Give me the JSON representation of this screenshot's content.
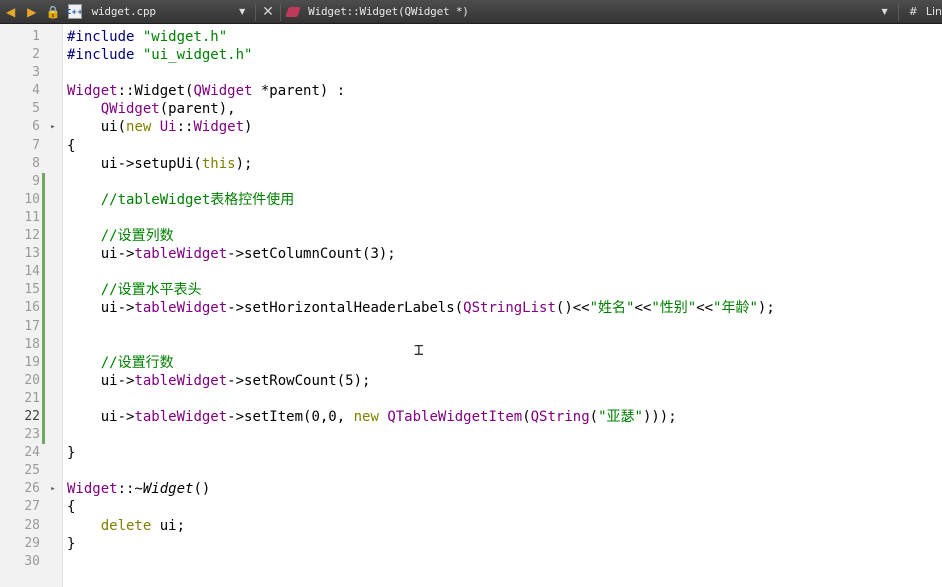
{
  "toolbar": {
    "file_name": "widget.cpp",
    "file_icon_text": "C++",
    "symbol": "Widget::Widget(QWidget *)",
    "hash": "#",
    "line_label": "Lin"
  },
  "editor": {
    "current_line": 22,
    "lines": [
      {
        "n": "1",
        "parts": [
          [
            "c-dir",
            "#include"
          ],
          [
            "",
            " "
          ],
          [
            "c-str",
            "\"widget.h\""
          ]
        ]
      },
      {
        "n": "2",
        "parts": [
          [
            "c-dir",
            "#include"
          ],
          [
            "",
            " "
          ],
          [
            "c-str",
            "\"ui_widget.h\""
          ]
        ]
      },
      {
        "n": "3",
        "parts": []
      },
      {
        "n": "4",
        "parts": [
          [
            "c-type",
            "Widget"
          ],
          [
            "",
            "::Widget("
          ],
          [
            "c-type",
            "QWidget"
          ],
          [
            "",
            " *parent) :"
          ]
        ]
      },
      {
        "n": "5",
        "parts": [
          [
            "",
            "    "
          ],
          [
            "c-type",
            "QWidget"
          ],
          [
            "",
            "(parent),"
          ]
        ]
      },
      {
        "n": "6",
        "fold": "▸",
        "parts": [
          [
            "",
            "    ui("
          ],
          [
            "c-kw",
            "new"
          ],
          [
            "",
            " "
          ],
          [
            "c-type",
            "Ui"
          ],
          [
            "",
            "::"
          ],
          [
            "c-type",
            "Widget"
          ],
          [
            "",
            ")"
          ]
        ]
      },
      {
        "n": "7",
        "parts": [
          [
            "",
            "{"
          ]
        ]
      },
      {
        "n": "8",
        "parts": [
          [
            "",
            "    ui->setupUi("
          ],
          [
            "c-kw",
            "this"
          ],
          [
            "",
            ");"
          ]
        ]
      },
      {
        "n": "9",
        "mark": true,
        "parts": []
      },
      {
        "n": "10",
        "mark": true,
        "parts": [
          [
            "c-com",
            "    //tableWidget表格控件使用"
          ]
        ]
      },
      {
        "n": "11",
        "mark": true,
        "parts": []
      },
      {
        "n": "12",
        "mark": true,
        "parts": [
          [
            "c-com",
            "    //设置列数"
          ]
        ]
      },
      {
        "n": "13",
        "mark": true,
        "parts": [
          [
            "",
            "    ui->"
          ],
          [
            "c-type",
            "tableWidget"
          ],
          [
            "",
            "->setColumnCount(3);"
          ]
        ]
      },
      {
        "n": "14",
        "mark": true,
        "parts": []
      },
      {
        "n": "15",
        "mark": true,
        "parts": [
          [
            "c-com",
            "    //设置水平表头"
          ]
        ]
      },
      {
        "n": "16",
        "mark": true,
        "parts": [
          [
            "",
            "    ui->"
          ],
          [
            "c-type",
            "tableWidget"
          ],
          [
            "",
            "->setHorizontalHeaderLabels("
          ],
          [
            "c-type",
            "QStringList"
          ],
          [
            "",
            "()<<"
          ],
          [
            "c-str",
            "\"姓名\""
          ],
          [
            "",
            "<<"
          ],
          [
            "c-str",
            "\"性别\""
          ],
          [
            "",
            "<<"
          ],
          [
            "c-str",
            "\"年龄\""
          ],
          [
            "",
            ");"
          ]
        ]
      },
      {
        "n": "17",
        "mark": true,
        "parts": []
      },
      {
        "n": "18",
        "mark": true,
        "parts": []
      },
      {
        "n": "19",
        "mark": true,
        "parts": [
          [
            "c-com",
            "    //设置行数"
          ]
        ]
      },
      {
        "n": "20",
        "mark": true,
        "parts": [
          [
            "",
            "    ui->"
          ],
          [
            "c-type",
            "tableWidget"
          ],
          [
            "",
            "->setRowCount(5);"
          ]
        ]
      },
      {
        "n": "21",
        "mark": true,
        "parts": []
      },
      {
        "n": "22",
        "mark": true,
        "parts": [
          [
            "",
            "    ui->"
          ],
          [
            "c-type",
            "tableWidget"
          ],
          [
            "",
            "->setItem(0,0, "
          ],
          [
            "c-kw",
            "new"
          ],
          [
            "",
            " "
          ],
          [
            "c-type",
            "QTableWidgetItem"
          ],
          [
            "",
            "("
          ],
          [
            "c-type",
            "QString"
          ],
          [
            "",
            "("
          ],
          [
            "c-str",
            "\"亚瑟\""
          ],
          [
            "",
            ")));"
          ]
        ]
      },
      {
        "n": "23",
        "mark": true,
        "parts": []
      },
      {
        "n": "24",
        "parts": [
          [
            "",
            "}"
          ]
        ]
      },
      {
        "n": "25",
        "parts": []
      },
      {
        "n": "26",
        "fold": "▸",
        "parts": [
          [
            "c-type",
            "Widget"
          ],
          [
            "",
            "::~"
          ],
          [
            "c-it",
            "Widget"
          ],
          [
            "",
            "()"
          ]
        ]
      },
      {
        "n": "27",
        "parts": [
          [
            "",
            "{"
          ]
        ]
      },
      {
        "n": "28",
        "parts": [
          [
            "",
            "    "
          ],
          [
            "c-kw",
            "delete"
          ],
          [
            "",
            " ui;"
          ]
        ]
      },
      {
        "n": "29",
        "parts": [
          [
            "",
            "}"
          ]
        ]
      },
      {
        "n": "30",
        "parts": []
      }
    ]
  }
}
